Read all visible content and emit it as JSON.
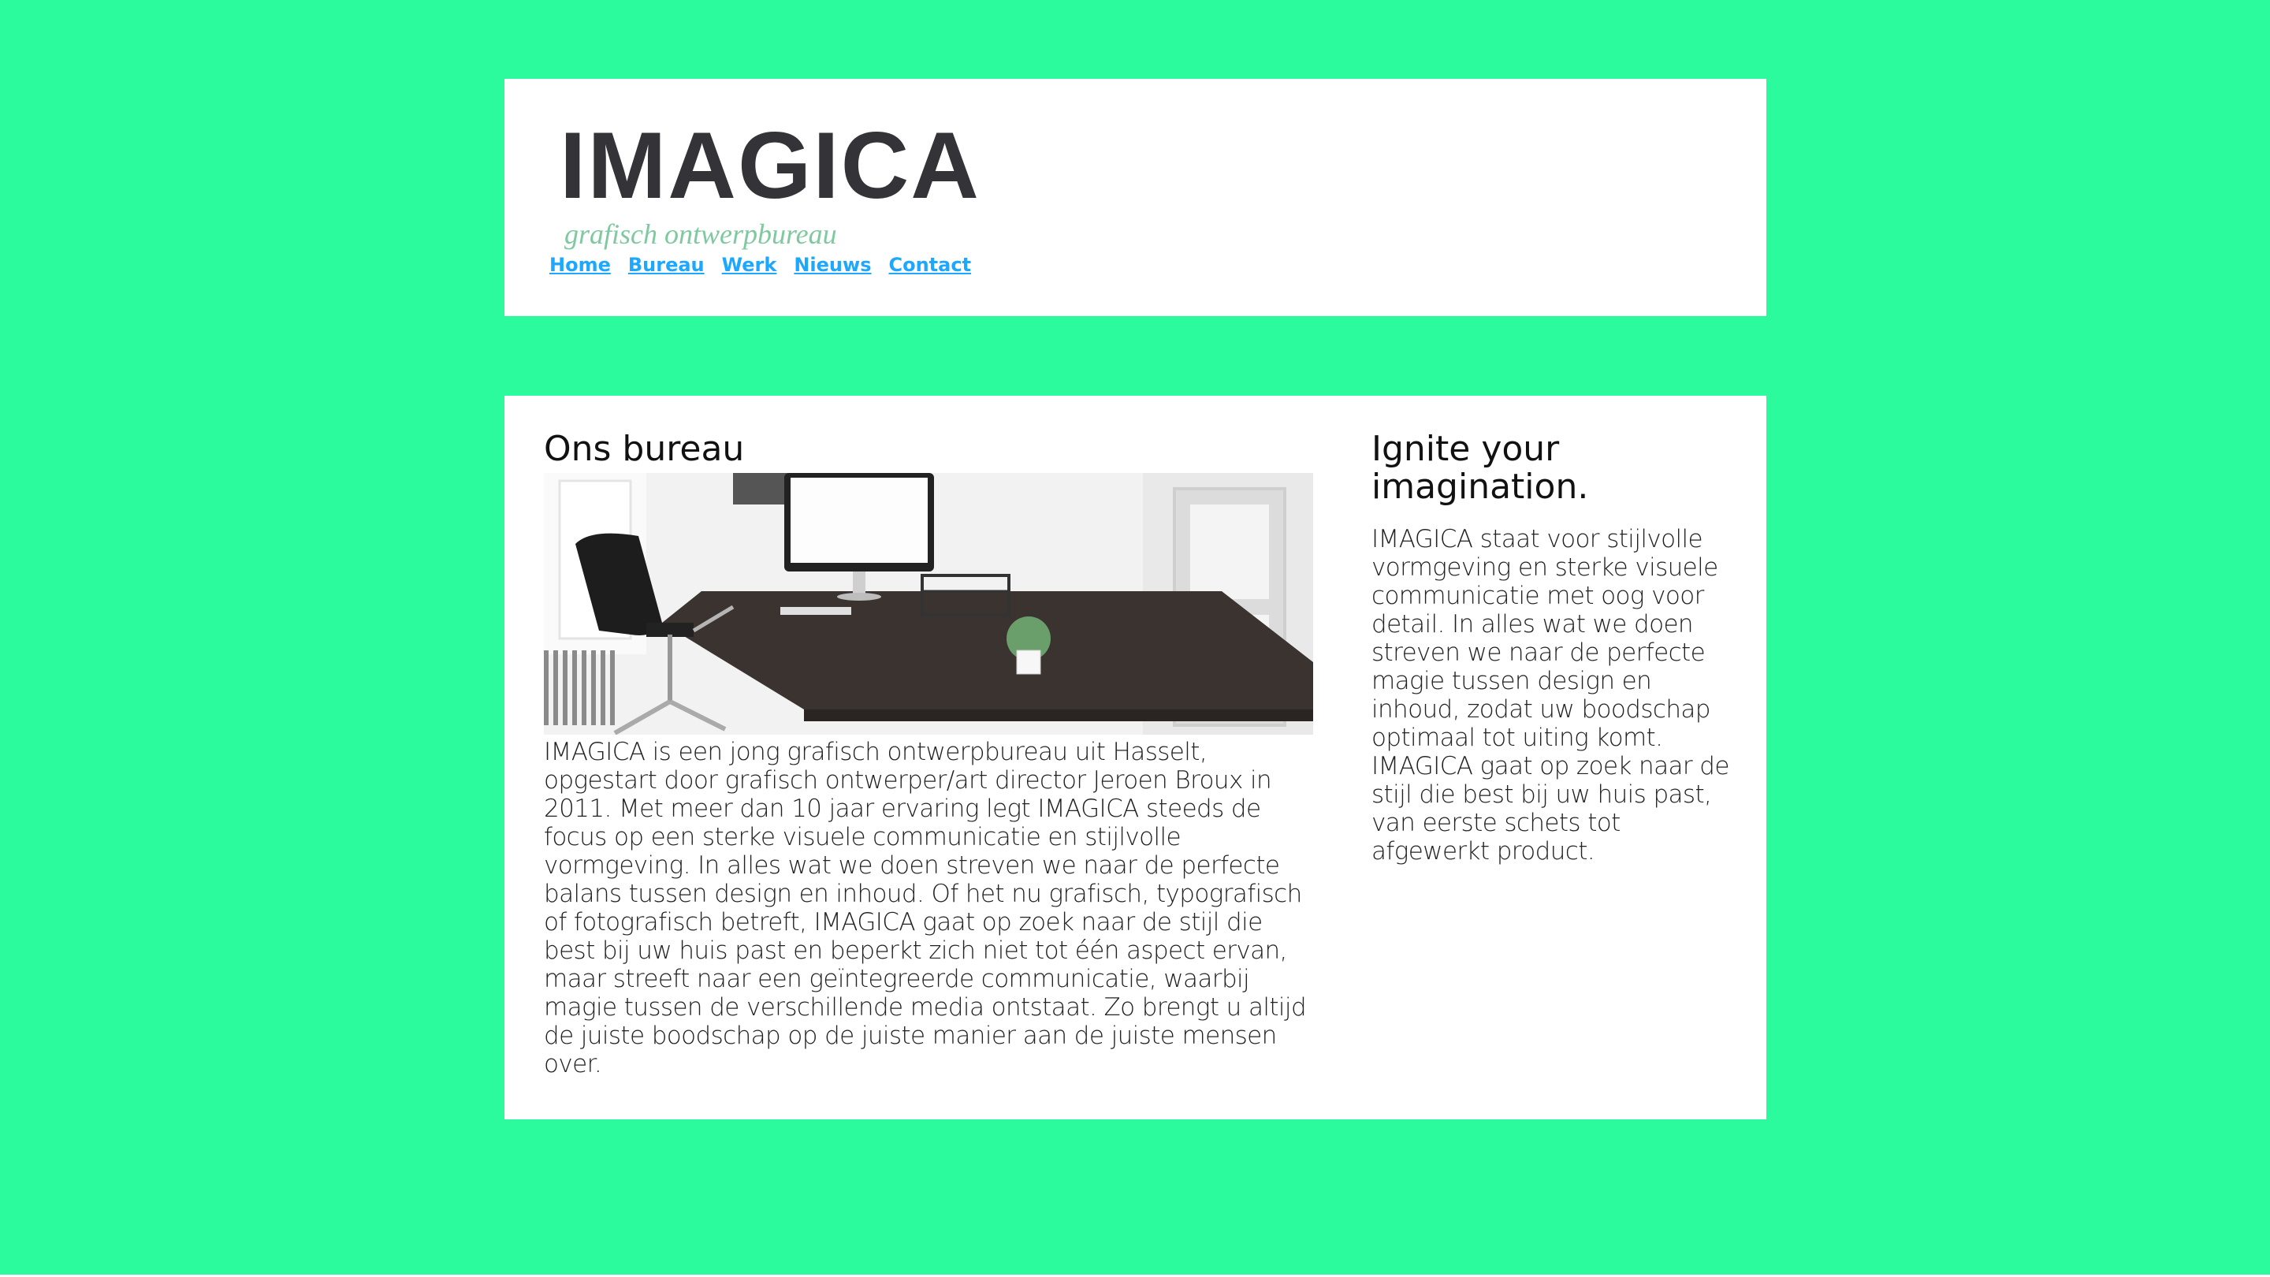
{
  "header": {
    "logo": {
      "name": "IMAGICA",
      "tagline": "grafisch ontwerpbureau"
    },
    "nav": [
      {
        "label": "Home"
      },
      {
        "label": "Bureau"
      },
      {
        "label": "Werk"
      },
      {
        "label": "Nieuws"
      },
      {
        "label": "Contact"
      }
    ]
  },
  "main": {
    "left": {
      "heading": "Ons bureau",
      "image_alt": "office-desk-photo",
      "text": "IMAGICA is een jong grafisch ontwerpbureau uit Hasselt, opgestart door grafisch ontwerper/art director Jeroen Broux in 2011. Met meer dan 10 jaar ervaring legt IMAGICA steeds de focus op een sterke visuele communicatie en stijlvolle vormgeving. In alles wat we doen streven we naar de perfecte balans tussen design en inhoud. Of het nu grafisch, typografisch of fotografisch betreft, IMAGICA gaat op zoek naar de stijl die best bij uw huis past en beperkt zich niet tot één aspect ervan, maar streeft naar een geïntegreerde communicatie, waarbij magie tussen de verschillende media ontstaat. Zo brengt u altijd de juiste boodschap op de juiste manier aan de juiste mensen over."
    },
    "right": {
      "heading": "Ignite your imagination.",
      "text": "IMAGICA staat voor stijlvolle vormgeving en sterke visuele communicatie met oog voor detail. In alles wat we doen streven we naar de perfecte magie tussen design en inhoud, zodat uw boodschap optimaal tot uiting komt. IMAGICA gaat op zoek naar de stijl die best bij uw huis past, van eerste schets tot afgewerkt product."
    }
  },
  "colors": {
    "background": "#2bfb9c",
    "panel": "#ffffff",
    "link": "#1ea7ff",
    "logo_text": "#333338",
    "tagline": "#7fc9a0"
  }
}
